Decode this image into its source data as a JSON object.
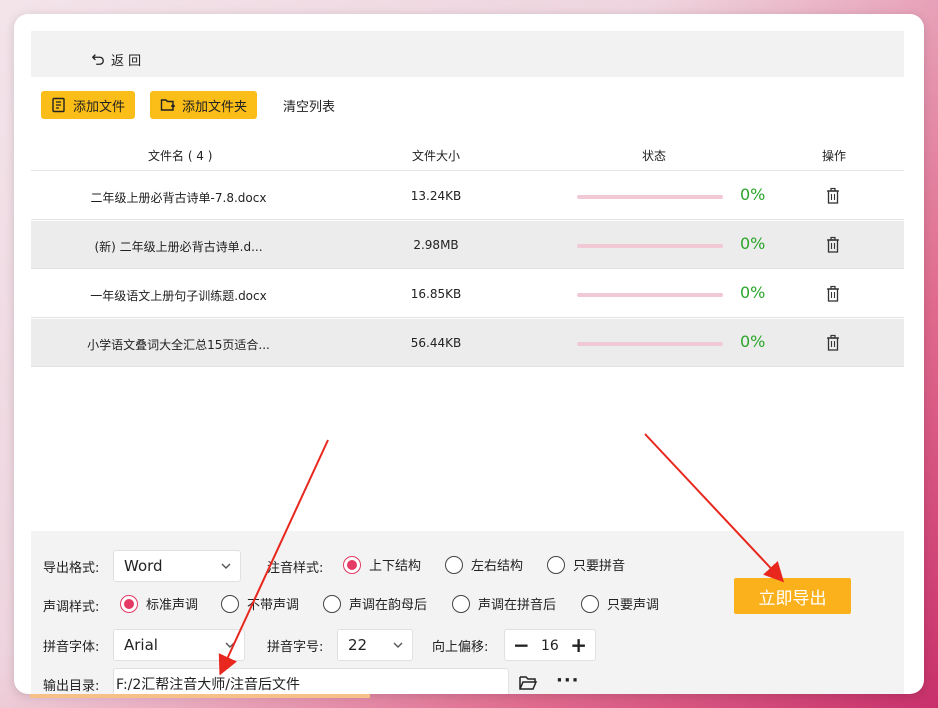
{
  "nav": {
    "back_label": "返 回"
  },
  "toolbar": {
    "add_file": "添加文件",
    "add_folder": "添加文件夹",
    "clear_list": "清空列表"
  },
  "table": {
    "headers": {
      "name": "文件名 ( 4 )",
      "size": "文件大小",
      "status": "状态",
      "action": "操作"
    },
    "rows": [
      {
        "name": "二年级上册必背古诗单-7.8.docx",
        "size": "13.24KB",
        "status": "0%",
        "progress": 0
      },
      {
        "name": "(新) 二年级上册必背古诗单.d...",
        "size": "2.98MB",
        "status": "0%",
        "progress": 0
      },
      {
        "name": "一年级语文上册句子训练题.docx",
        "size": "16.85KB",
        "status": "0%",
        "progress": 0
      },
      {
        "name": "小学语文叠词大全汇总15页适合...",
        "size": "56.44KB",
        "status": "0%",
        "progress": 0
      }
    ]
  },
  "settings": {
    "export_format_label": "导出格式:",
    "export_format_value": "Word",
    "annotation_style_label": "注音样式:",
    "annotation_options": [
      "上下结构",
      "左右结构",
      "只要拼音"
    ],
    "annotation_selected": 0,
    "tone_style_label": "声调样式:",
    "tone_options": [
      "标准声调",
      "不带声调",
      "声调在韵母后",
      "声调在拼音后",
      "只要声调"
    ],
    "tone_selected": 0,
    "pinyin_font_label": "拼音字体:",
    "pinyin_font_value": "Arial",
    "pinyin_size_label": "拼音字号:",
    "pinyin_size_value": "22",
    "offset_label": "向上偏移:",
    "offset_minus": "−",
    "offset_value": "16",
    "offset_plus": "+",
    "output_dir_label": "输出目录:",
    "output_dir_value": "F:/2汇帮注音大师/注音后文件",
    "more_label": "···"
  },
  "export_button": "立即导出",
  "colors": {
    "accent_yellow": "#fbbd17",
    "radio_active": "#e53a64",
    "status_green": "#2aa52a",
    "arrow_red": "#e8281f"
  }
}
